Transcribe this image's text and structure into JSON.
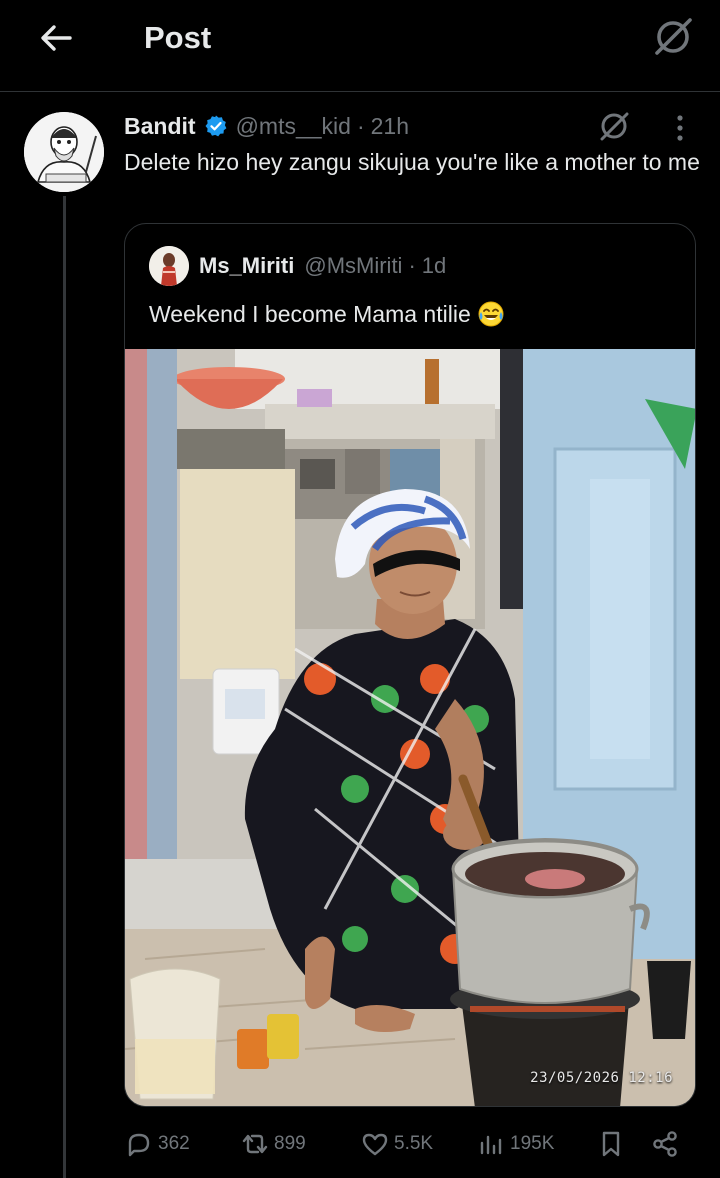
{
  "header": {
    "title": "Post"
  },
  "post": {
    "name": "Bandit",
    "handle": "@mts__kid",
    "separator": "·",
    "time": "21h",
    "text": "Delete hizo hey zangu sikujua you're like a mother to me"
  },
  "quote": {
    "name": "Ms_Miriti",
    "handle": "@MsMiriti",
    "separator": "·",
    "time": "1d",
    "text": "Weekend I become Mama ntilie",
    "emoji": "face-with-tears-of-joy",
    "image_timestamp": "23/05/2026 12:16"
  },
  "stats": {
    "replies": "362",
    "reposts": "899",
    "likes": "5.5K",
    "views": "195K"
  },
  "colors": {
    "background": "#000000",
    "text": "#e7e9ea",
    "muted": "#71767b",
    "border": "#2f3336",
    "verified": "#1d9bf0"
  },
  "icons": [
    "back-arrow-icon",
    "grok-icon",
    "verified-badge-icon",
    "more-icon",
    "reply-icon",
    "repost-icon",
    "like-icon",
    "views-icon",
    "bookmark-icon",
    "share-icon"
  ]
}
